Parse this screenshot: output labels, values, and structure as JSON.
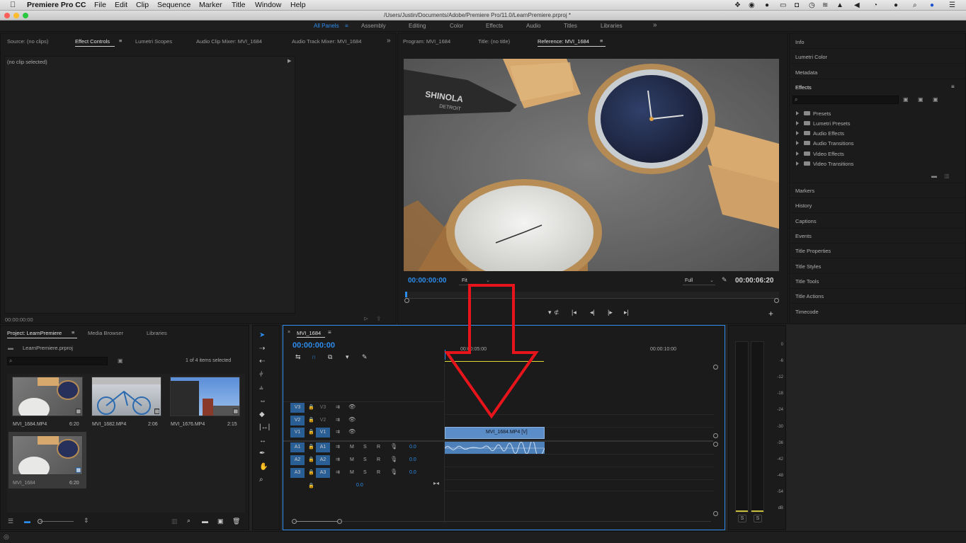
{
  "menubar": {
    "app": "Premiere Pro CC",
    "items": [
      "File",
      "Edit",
      "Clip",
      "Sequence",
      "Marker",
      "Title",
      "Window",
      "Help"
    ]
  },
  "window": {
    "path": "/Users/Justin/Documents/Adobe/Premiere Pro/11.0/LearnPremiere.prproj *"
  },
  "workspaces": {
    "items": [
      "All Panels",
      "Assembly",
      "Editing",
      "Color",
      "Effects",
      "Audio",
      "Titles",
      "Libraries"
    ],
    "active": "All Panels",
    "more": "»"
  },
  "source_panel": {
    "tabs": [
      "Source: (no clips)",
      "Effect Controls",
      "Lumetri Scopes",
      "Audio Clip Mixer: MVI_1684",
      "Audio Track Mixer: MVI_1684"
    ],
    "no_clip": "(no clip selected)",
    "timecode": "00:00:00:00"
  },
  "program_panel": {
    "tabs": [
      "Program: MVI_1684",
      "Title: (no title)",
      "Reference: MVI_1684"
    ],
    "timecode_in": "00:00:00:00",
    "fit": "Fit",
    "quality": "Full",
    "timecode_out": "00:00:06:20",
    "brand_text": "SHINOLA",
    "brand_sub": "DETROIT"
  },
  "right_panel": {
    "top": [
      "Info",
      "Lumetri Color",
      "Metadata"
    ],
    "effects_title": "Effects",
    "effects_tree": [
      "Presets",
      "Lumetri Presets",
      "Audio Effects",
      "Audio Transitions",
      "Video Effects",
      "Video Transitions"
    ],
    "bottom": [
      "Markers",
      "History",
      "Captions",
      "Events",
      "Title Properties",
      "Title Styles",
      "Title Tools",
      "Title Actions",
      "Timecode"
    ]
  },
  "project_panel": {
    "tabs": [
      "Project: LearnPremiere",
      "Media Browser",
      "Libraries"
    ],
    "project_file": "LearnPremiere.prproj",
    "selection": "1 of 4 items selected",
    "clips": [
      {
        "name": "MVI_1684.MP4",
        "dur": "6:20"
      },
      {
        "name": "MVI_1682.MP4",
        "dur": "2:06"
      },
      {
        "name": "MVI_1676.MP4",
        "dur": "2:15"
      },
      {
        "name": "MVI_1684",
        "dur": "6:20"
      }
    ]
  },
  "timeline": {
    "title": "MVI_1684",
    "timecode": "00:00:00:00",
    "ruler": [
      "00:00:05:00",
      "00:00:10:00"
    ],
    "video_tracks": [
      "V3",
      "V2",
      "V1"
    ],
    "audio_tracks": [
      "A1",
      "A2",
      "A3"
    ],
    "mute": "M",
    "solo": "S",
    "record": "R",
    "audio_vol": "0.0",
    "master_vol": "0.0",
    "clip_label": "MVI_1684.MP4 [V]"
  },
  "meter": {
    "scale": [
      "0",
      "-6",
      "-12",
      "-18",
      "-24",
      "-30",
      "-36",
      "-42",
      "-48",
      "-54",
      "dB"
    ],
    "solo": "S"
  },
  "colors": {
    "accent": "#2d8ceb",
    "clip_video": "#5b8dc9",
    "clip_audio": "#4d7fb8",
    "annotation": "#e8141b"
  }
}
